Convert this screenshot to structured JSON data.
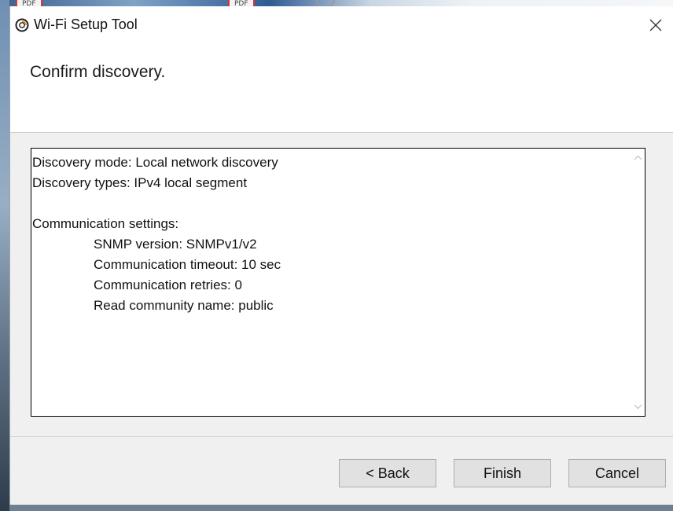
{
  "window": {
    "title": "Wi-Fi Setup Tool",
    "heading": "Confirm discovery."
  },
  "summary": {
    "lines": [
      "Discovery mode: Local network discovery",
      "Discovery types: IPv4 local segment",
      "Communication settings:"
    ],
    "settings": [
      "SNMP version: SNMPv1/v2",
      "Communication timeout: 10 sec",
      "Communication retries: 0",
      "Read community name: public"
    ]
  },
  "buttons": {
    "back": "< Back",
    "finish": "Finish",
    "cancel": "Cancel"
  },
  "icons": {
    "app": "wifi-setup-app-icon",
    "close": "close-icon",
    "scroll_up": "scroll-up-arrow-icon",
    "scroll_down": "scroll-down-arrow-icon"
  },
  "desktop": {
    "tab_labels": [
      "PDF",
      "PDF"
    ]
  }
}
